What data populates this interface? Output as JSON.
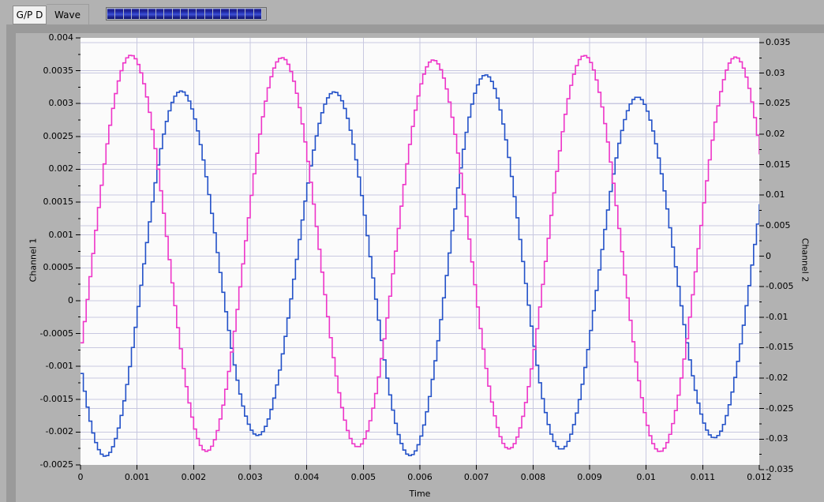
{
  "tabs": [
    {
      "label": "G/P D",
      "selected": false
    },
    {
      "label": "Wave",
      "selected": true
    }
  ],
  "progress": {
    "segments_filled": 19,
    "fill_color": "#2333b4",
    "style": "segmented"
  },
  "colors": {
    "panel_gray": "#b2b2b2",
    "page_edge_gray": "#9a9a9a",
    "plot_background": "#fbfbfb",
    "grid": "#c8c8e0",
    "channel1_trace": "#ee35c8",
    "channel2_trace": "#2351c8",
    "tick": "#000000"
  },
  "chart_data": {
    "type": "line",
    "title": "",
    "grid": true,
    "x_axis": {
      "label": "Time",
      "min": 0,
      "max": 0.012,
      "tick_step": 0.001,
      "ticks": [
        "0",
        "0.001",
        "0.002",
        "0.003",
        "0.004",
        "0.005",
        "0.006",
        "0.007",
        "0.008",
        "0.009",
        "0.01",
        "0.011",
        "0.012"
      ]
    },
    "y_axis_left": {
      "label": "Channel 1",
      "min": -0.0025,
      "max": 0.004,
      "tick_step": 0.0005,
      "ticks": [
        "0.004",
        "0.0035",
        "0.003",
        "0.0025",
        "0.002",
        "0.0015",
        "0.001",
        "0.0005",
        "0",
        "-0.0005",
        "-0.001",
        "-0.0015",
        "-0.002",
        "-0.0025"
      ]
    },
    "y_axis_right": {
      "label": "Channel 2",
      "min": -0.035,
      "max": 0.035,
      "tick_step": 0.005,
      "ticks": [
        "0.035",
        "0.03",
        "0.025",
        "0.02",
        "0.015",
        "0.01",
        "0.005",
        "0",
        "-0.005",
        "-0.01",
        "-0.015",
        "-0.02",
        "-0.025",
        "-0.03",
        "-0.035"
      ]
    },
    "sampling": {
      "interval_s": 5e-05,
      "duration_s": 0.012,
      "interpolation": "step"
    },
    "series": [
      {
        "name": "Channel 1",
        "axis": "left",
        "color": "#ee35c8",
        "waveform": "sine",
        "offset": 0.00072,
        "amplitude": 0.00298,
        "frequency_hz": 374.2,
        "phase_rad": -0.471,
        "amplitude_mod": {
          "amount": 4e-05,
          "frequency_hz": 120,
          "phase_rad": 0.5
        },
        "observed_peaks": [
          0.0037,
          0.0037,
          0.0037,
          0.0037,
          0.0037
        ],
        "observed_minima": [
          -0.0023,
          -0.0023,
          -0.0023,
          -0.0023
        ]
      },
      {
        "name": "Channel 2",
        "axis": "right",
        "color": "#2351c8",
        "waveform": "sine",
        "offset": -0.0018,
        "amplitude": 0.0296,
        "frequency_hz": 372,
        "phase_rad": 3.73,
        "amplitude_mod": {
          "amount": 0.002,
          "frequency_hz": 137,
          "phase_rad": 2.0
        },
        "observed_peaks": [
          0.026,
          0.03,
          0.027,
          0.026
        ],
        "observed_minima": [
          -0.03,
          -0.032,
          -0.028,
          -0.033,
          -0.033
        ]
      }
    ]
  }
}
